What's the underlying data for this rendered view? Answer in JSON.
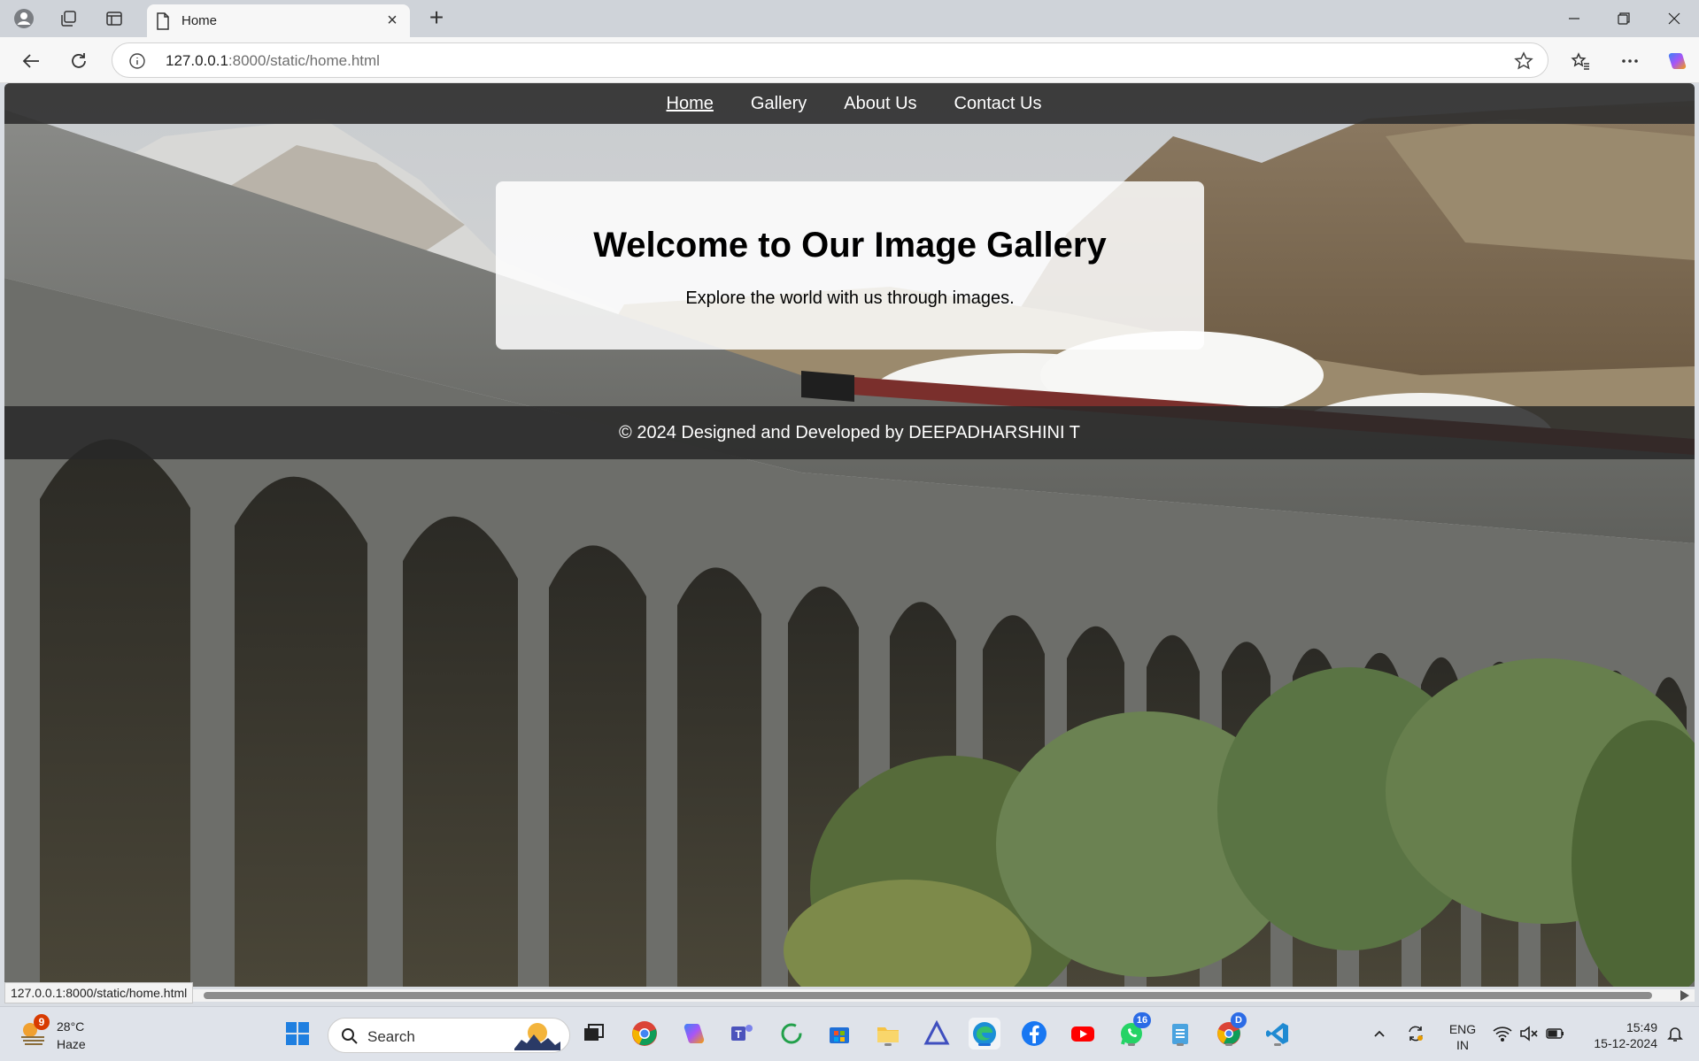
{
  "browser": {
    "tab_title": "Home",
    "url_host": "127.0.0.1",
    "url_rest": ":8000/static/home.html",
    "status_url": "127.0.0.1:8000/static/home.html"
  },
  "nav": {
    "items": [
      {
        "label": "Home",
        "active": true
      },
      {
        "label": "Gallery",
        "active": false
      },
      {
        "label": "About Us",
        "active": false
      },
      {
        "label": "Contact Us",
        "active": false
      }
    ]
  },
  "hero": {
    "title": "Welcome to Our Image Gallery",
    "subtitle": "Explore the world with us through images."
  },
  "footer": {
    "text": "© 2024 Designed and Developed by DEEPADHARSHINI T"
  },
  "taskbar": {
    "weather_temp": "28°C",
    "weather_cond": "Haze",
    "weather_badge": "9",
    "search_placeholder": "Search",
    "whatsapp_badge": "16",
    "chrome_profile_badge": "D",
    "lang_line1": "ENG",
    "lang_line2": "IN",
    "time": "15:49",
    "date": "15-12-2024"
  }
}
